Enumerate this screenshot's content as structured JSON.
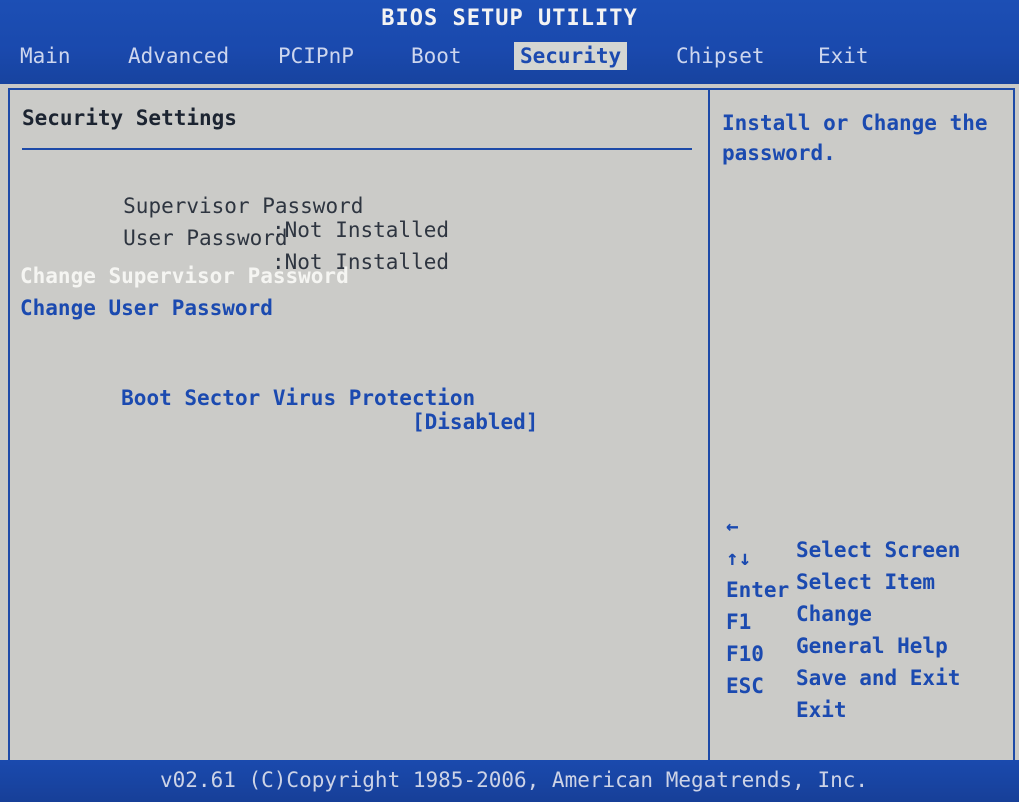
{
  "header": {
    "title": "BIOS SETUP UTILITY"
  },
  "tabs": [
    {
      "label": "Main"
    },
    {
      "label": "Advanced"
    },
    {
      "label": "PCIPnP"
    },
    {
      "label": "Boot"
    },
    {
      "label": "Security",
      "active": true
    },
    {
      "label": "Chipset"
    },
    {
      "label": "Exit"
    }
  ],
  "main": {
    "section_title": "Security Settings",
    "info": [
      {
        "label": "Supervisor Password",
        "value": ":Not Installed"
      },
      {
        "label": "User Password",
        "value": ":Not Installed"
      }
    ],
    "items": [
      {
        "label": "Change Supervisor Password",
        "selected": true
      },
      {
        "label": "Change User Password"
      }
    ],
    "setting": {
      "label": "Boot Sector Virus Protection",
      "value": "[Disabled]"
    }
  },
  "help": {
    "text": "Install or Change the password.",
    "keys": [
      {
        "key": "←",
        "desc": "Select Screen"
      },
      {
        "key": "↑↓",
        "desc": "Select Item"
      },
      {
        "key": "Enter",
        "desc": "Change"
      },
      {
        "key": "F1",
        "desc": "General Help"
      },
      {
        "key": "F10",
        "desc": "Save and Exit"
      },
      {
        "key": "ESC",
        "desc": "Exit"
      }
    ]
  },
  "footer": {
    "text": "v02.61 (C)Copyright 1985-2006, American Megatrends, Inc."
  },
  "colors": {
    "header_blue": "#1c4fb5",
    "panel_gray": "#cbcbc8",
    "item_blue": "#1b4ab0",
    "selected_white": "#f5f5f2"
  }
}
